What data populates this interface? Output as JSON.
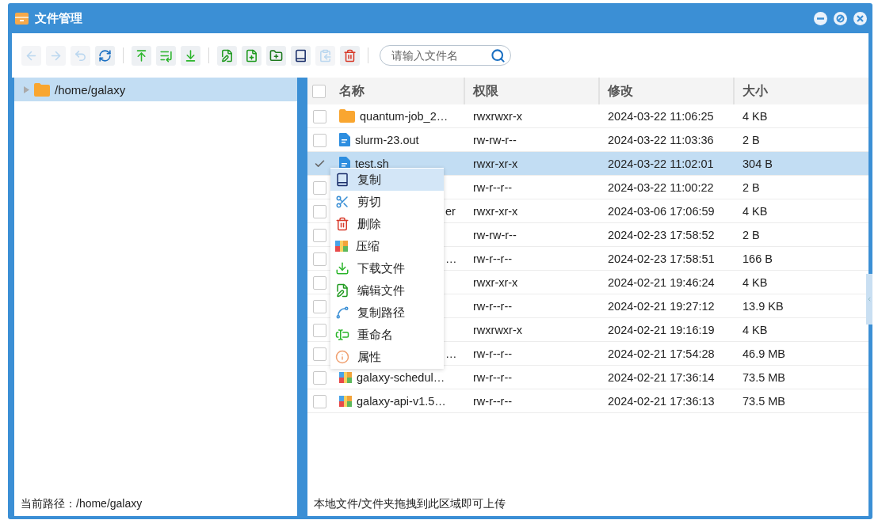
{
  "window": {
    "title": "文件管理"
  },
  "toolbar": {
    "groups": [
      [
        {
          "kind": "back",
          "disabled": true
        },
        {
          "kind": "forward",
          "disabled": true
        },
        {
          "kind": "undo",
          "disabled": true
        },
        {
          "kind": "refresh",
          "disabled": false
        }
      ],
      [
        {
          "kind": "upload",
          "disabled": false
        },
        {
          "kind": "upload-list",
          "disabled": false
        },
        {
          "kind": "download",
          "disabled": false
        }
      ],
      [
        {
          "kind": "edit",
          "disabled": false
        },
        {
          "kind": "new-file",
          "disabled": false
        },
        {
          "kind": "new-folder",
          "disabled": false
        },
        {
          "kind": "copy",
          "disabled": false
        },
        {
          "kind": "paste",
          "disabled": true
        },
        {
          "kind": "delete",
          "disabled": false
        }
      ]
    ],
    "search": {
      "placeholder": "请输入文件名"
    }
  },
  "tree": [
    {
      "label": "/home/galaxy",
      "selected": true,
      "expanded": false
    }
  ],
  "current_path": "当前路径：/home/galaxy",
  "table": {
    "header_checked": false,
    "columns": [
      "名称",
      "权限",
      "修改",
      "大小"
    ],
    "rows": [
      {
        "kind": "folder",
        "name": "quantum-job_2…",
        "permissions": "rwxrwxr-x",
        "modified": "2024-03-22 11:06:25",
        "size": "4 KB",
        "checked": false,
        "selected": false
      },
      {
        "kind": "file",
        "name": "slurm-23.out",
        "permissions": "rw-rw-r--",
        "modified": "2024-03-22 11:03:36",
        "size": "2 B",
        "checked": false,
        "selected": false
      },
      {
        "kind": "file",
        "name": "test.sh",
        "permissions": "rwxr-xr-x",
        "modified": "2024-03-22 11:02:01",
        "size": "304 B",
        "checked": true,
        "selected": true
      },
      {
        "kind": "covered",
        "permissions": "rw-r--r--",
        "modified": "2024-03-22 11:00:22",
        "size": "2 B",
        "checked": false,
        "selected": false
      },
      {
        "kind": "covered",
        "name": "er",
        "permissions": "rwxr-xr-x",
        "modified": "2024-03-06 17:06:59",
        "size": "4 KB",
        "checked": false,
        "selected": false
      },
      {
        "kind": "covered",
        "permissions": "rw-rw-r--",
        "modified": "2024-02-23 17:58:52",
        "size": "2 B",
        "checked": false,
        "selected": false
      },
      {
        "kind": "covered",
        "name": "…",
        "permissions": "rw-r--r--",
        "modified": "2024-02-23 17:58:51",
        "size": "166 B",
        "checked": false,
        "selected": false
      },
      {
        "kind": "covered",
        "permissions": "rwxr-xr-x",
        "modified": "2024-02-21 19:46:24",
        "size": "4 KB",
        "checked": false,
        "selected": false
      },
      {
        "kind": "covered",
        "permissions": "rw-r--r--",
        "modified": "2024-02-21 19:27:12",
        "size": "13.9 KB",
        "checked": false,
        "selected": false
      },
      {
        "kind": "covered",
        "permissions": "rwxrwxr-x",
        "modified": "2024-02-21 19:16:19",
        "size": "4 KB",
        "checked": false,
        "selected": false
      },
      {
        "kind": "covered",
        "name": "…",
        "permissions": "rw-r--r--",
        "modified": "2024-02-21 17:54:28",
        "size": "46.9 MB",
        "checked": false,
        "selected": false
      },
      {
        "kind": "archive",
        "name": "galaxy-schedul…",
        "permissions": "rw-r--r--",
        "modified": "2024-02-21 17:36:14",
        "size": "73.5 MB",
        "checked": false,
        "selected": false
      },
      {
        "kind": "archive",
        "name": "galaxy-api-v1.5…",
        "permissions": "rw-r--r--",
        "modified": "2024-02-21 17:36:13",
        "size": "73.5 MB",
        "checked": false,
        "selected": false
      }
    ]
  },
  "context_menu": [
    {
      "kind": "copy",
      "label": "复制",
      "selected": true
    },
    {
      "kind": "cut",
      "label": "剪切",
      "selected": false
    },
    {
      "kind": "delete",
      "label": "删除",
      "selected": false
    },
    {
      "kind": "compress",
      "label": "压缩",
      "selected": false
    },
    {
      "kind": "download",
      "label": "下载文件",
      "selected": false
    },
    {
      "kind": "edit",
      "label": "编辑文件",
      "selected": false
    },
    {
      "kind": "copy-path",
      "label": "复制路径",
      "selected": false
    },
    {
      "kind": "rename",
      "label": "重命名",
      "selected": false
    },
    {
      "kind": "properties",
      "label": "属性",
      "selected": false
    }
  ],
  "drop_hint": "本地文件/文件夹拖拽到此区域即可上传"
}
